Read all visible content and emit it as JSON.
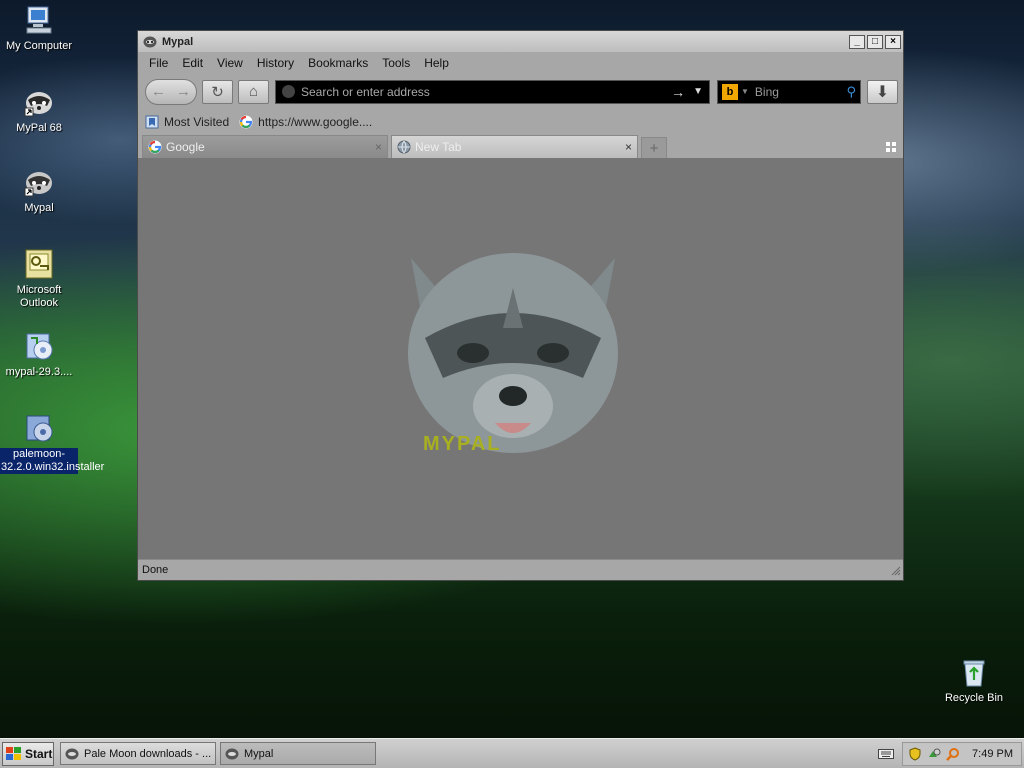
{
  "desktop": {
    "icons": [
      {
        "label": "My Computer"
      },
      {
        "label": "MyPal 68"
      },
      {
        "label": "Mypal"
      },
      {
        "label": "Microsoft Outlook"
      },
      {
        "label": "mypal-29.3...."
      },
      {
        "label": "palemoon-32.2.0.win32.installer"
      },
      {
        "label": "Recycle Bin"
      }
    ]
  },
  "window": {
    "title": "Mypal",
    "controls": {
      "minimize": "_",
      "maximize": "□",
      "close": "×"
    },
    "menu": [
      "File",
      "Edit",
      "View",
      "History",
      "Bookmarks",
      "Tools",
      "Help"
    ],
    "nav": {
      "back_glyph": "←",
      "forward_glyph": "→",
      "reload_glyph": "↻",
      "home_glyph": "⌂",
      "url_placeholder": "Search or enter address",
      "go_glyph": "→",
      "dropdown_glyph": "▼",
      "search_engine_letter": "b",
      "search_engine_drop": "▼",
      "search_placeholder": "Bing",
      "search_glyph": "⚲",
      "download_glyph": "⬇"
    },
    "bookmarks": [
      {
        "label": "Most Visited",
        "icon": "bookmark-icon"
      },
      {
        "label": "https://www.google....",
        "icon": "google-icon"
      }
    ],
    "tabs": [
      {
        "label": "Google",
        "icon": "google-icon",
        "active": false,
        "close": "×"
      },
      {
        "label": "New Tab",
        "icon": "globe-icon",
        "active": true,
        "close": "×"
      }
    ],
    "new_tab_glyph": "+",
    "content": {
      "logo_text": "MYPAL"
    },
    "status": "Done"
  },
  "taskbar": {
    "start_label": "Start",
    "tasks": [
      {
        "label": "Pale Moon downloads - ...",
        "active": false
      },
      {
        "label": "Mypal",
        "active": true
      }
    ],
    "clock": "7:49 PM"
  },
  "colors": {
    "window_chrome": "#a7a7a7",
    "content_bg": "#767676",
    "urlbar_bg": "#000000",
    "bing_accent": "#f0a800",
    "selection": "#0a246a",
    "logo_text": "#a8b020"
  }
}
